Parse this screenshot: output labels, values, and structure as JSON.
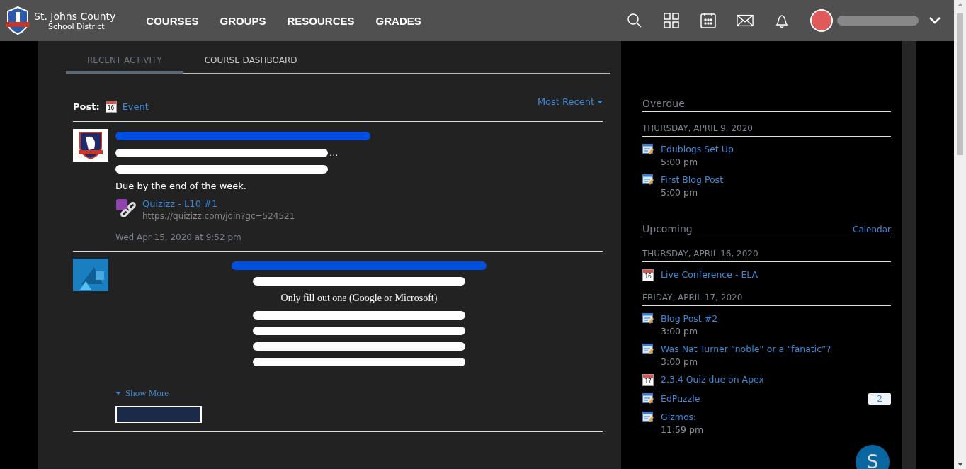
{
  "header": {
    "logo_line1": "St. Johns County",
    "logo_line2": "School District",
    "nav": [
      "COURSES",
      "GROUPS",
      "RESOURCES",
      "GRADES"
    ]
  },
  "tabs": [
    {
      "label": "RECENT ACTIVITY",
      "selected": true
    },
    {
      "label": "COURSE DASHBOARD",
      "selected": false
    }
  ],
  "post_bar": {
    "label": "Post:",
    "event_icon_day": "16",
    "option": "Event",
    "sort": "Most Recent"
  },
  "feed": [
    {
      "kind": "crest",
      "lines": [
        {
          "kind": "redacted",
          "tail": "..."
        },
        {
          "kind": "redacted"
        },
        {
          "kind": "text",
          "text": "Due by the end of the week."
        }
      ],
      "attachment": {
        "title": "Quizizz - L10 #1",
        "url": "https://quizizz.com/join?gc=524521"
      },
      "timestamp": "Wed Apr 15, 2020 at 9:52 pm"
    },
    {
      "kind": "shapes",
      "lines": [
        {
          "kind": "redacted"
        },
        {
          "kind": "text",
          "text": "Only fill out one (Google or Microsoft)"
        },
        {
          "kind": "redacted"
        },
        {
          "kind": "redacted"
        },
        {
          "kind": "redacted"
        },
        {
          "kind": "redacted"
        }
      ],
      "show_more": "Show More"
    }
  ],
  "sidebar": {
    "sections": [
      {
        "title": "Overdue",
        "days": [
          {
            "date": "THURSDAY, APRIL 9, 2020",
            "items": [
              {
                "kind": "assignment",
                "title": "Edublogs Set Up",
                "time": "5:00 pm"
              },
              {
                "kind": "assignment",
                "title": "First Blog Post",
                "time": "5:00 pm"
              }
            ]
          }
        ]
      },
      {
        "title": "Upcoming",
        "link": "Calendar",
        "days": [
          {
            "date": "THURSDAY, APRIL 16, 2020",
            "items": [
              {
                "kind": "event",
                "icon_day": "16",
                "title": "Live Conference - ELA"
              }
            ]
          },
          {
            "date": "FRIDAY, APRIL 17, 2020",
            "items": [
              {
                "kind": "assignment",
                "title": "Blog Post #2",
                "time": "3:00 pm"
              },
              {
                "kind": "assignment",
                "title": "Was Nat Turner “noble” or a “fanatic”?",
                "time": "3:00 pm"
              },
              {
                "kind": "event",
                "icon_day": "17",
                "title": "2.3.4 Quiz due on Apex"
              },
              {
                "kind": "assignment",
                "title": "EdPuzzle",
                "badge": "2"
              },
              {
                "kind": "assignment",
                "title": "Gizmos:",
                "time": "11:59 pm"
              }
            ]
          }
        ]
      }
    ]
  },
  "help_button": "S"
}
